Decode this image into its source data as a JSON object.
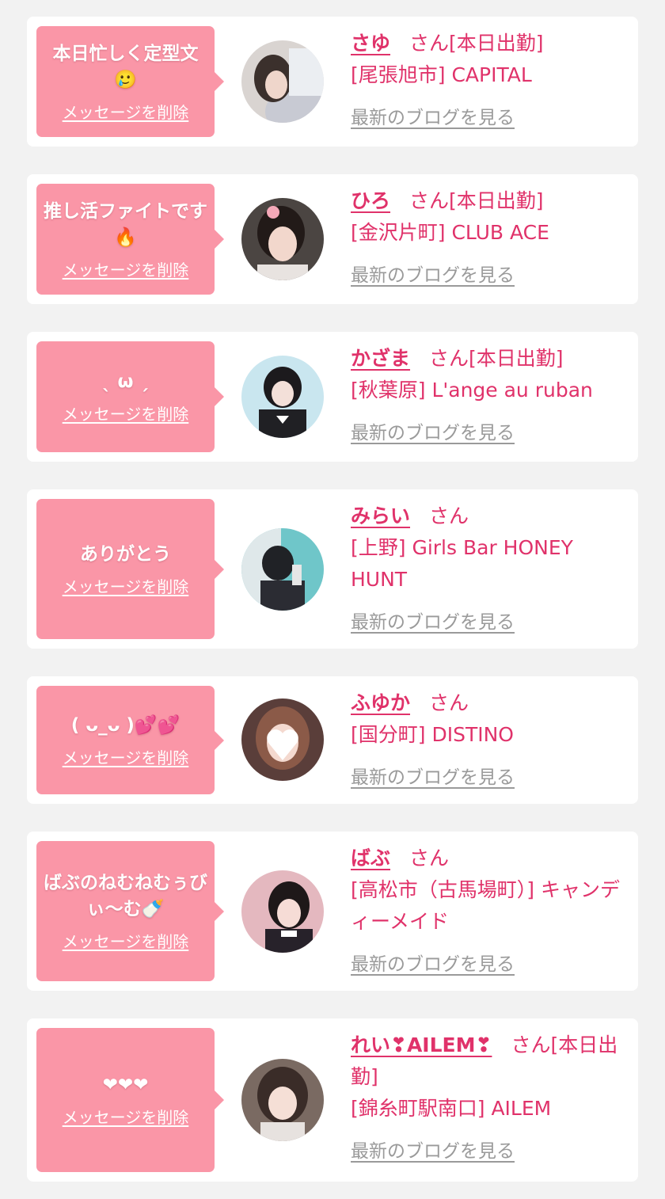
{
  "delete_label": "メッセージを削除",
  "blog_label": "最新のブログを見る",
  "honorific": "さん",
  "colors": {
    "bubble": "#fa96a7",
    "accent": "#e0326a",
    "link_gray": "#9a9a9a",
    "background": "#f2f2f2"
  },
  "entries": [
    {
      "message": "本日忙しく定型文🥲",
      "name": "さゆ",
      "status": "[本日出勤]",
      "shop": "[尾張旭市] CAPITAL"
    },
    {
      "message": "推し活ファイトです🔥",
      "name": "ひろ",
      "status": "[本日出勤]",
      "shop": "[金沢片町] CLUB ACE"
    },
    {
      "message": "ˎ ω ˏ",
      "name": "かざま",
      "status": "[本日出勤]",
      "shop": "[秋葉原] L'ange au ruban"
    },
    {
      "message": "ありがとう",
      "name": "みらい",
      "status": "",
      "shop": "[上野] Girls Bar HONEY HUNT"
    },
    {
      "message": "( ᴗ_ᴗ )💕💕",
      "name": "ふゆか",
      "status": "",
      "shop": "[国分町] DISTINO"
    },
    {
      "message": "ばぶのねむねむぅびぃ〜む🍼",
      "name": "ばぶ",
      "status": "",
      "shop": "[高松市（古馬場町）] キャンディーメイド"
    },
    {
      "message": "❤❤❤",
      "name": "れい❣AILEM❣",
      "status": "[本日出勤]",
      "shop": "[錦糸町駅南口] AILEM"
    }
  ]
}
